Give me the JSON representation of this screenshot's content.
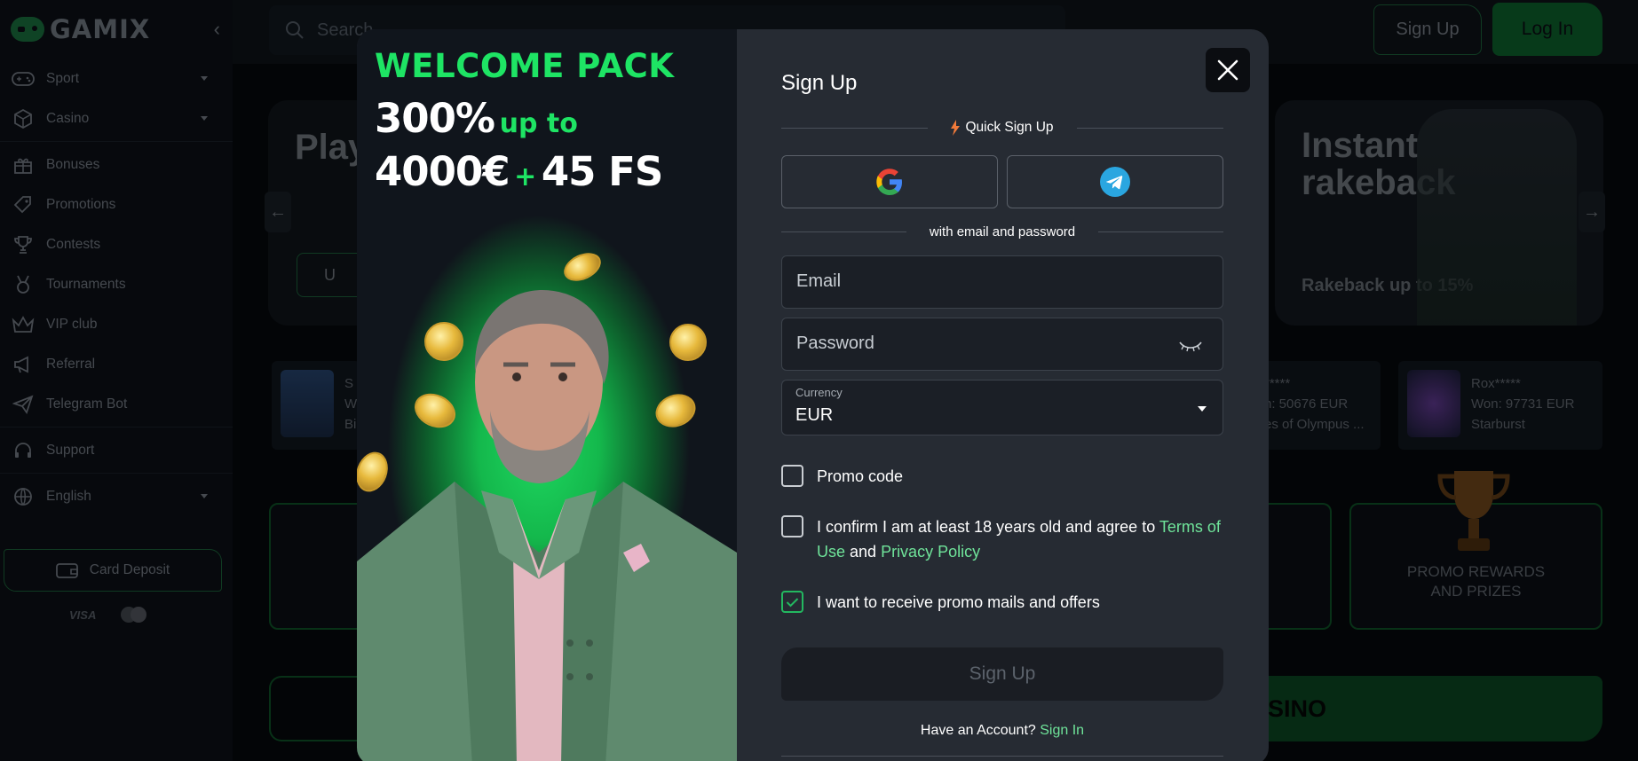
{
  "sidebar": {
    "logo": "GAMIX",
    "items": [
      {
        "label": "Sport"
      },
      {
        "label": "Casino"
      },
      {
        "label": "Bonuses"
      },
      {
        "label": "Promotions"
      },
      {
        "label": "Contests"
      },
      {
        "label": "Tournaments"
      },
      {
        "label": "VIP club"
      },
      {
        "label": "Referral"
      },
      {
        "label": "Telegram Bot"
      },
      {
        "label": "Support"
      },
      {
        "label": "English"
      }
    ],
    "deposit_label": "Card Deposit",
    "visa_label": "VISA"
  },
  "header": {
    "search_placeholder": "Search",
    "signup_label": "Sign Up",
    "login_label": "Log In"
  },
  "background": {
    "hero_left_title": "Play",
    "hero_left_button": "U",
    "hero_right_title": "Instant rakeback",
    "hero_right_sub": "Rakeback up to 15%",
    "winners": [
      {
        "user": "S",
        "amount": "W",
        "game": "Bi"
      },
      {
        "user": "*****",
        "amount": "n: 50676 EUR",
        "game": "es of Olympus ..."
      },
      {
        "user": "Rox*****",
        "amount": "Won: 97731 EUR",
        "game": "Starburst"
      }
    ],
    "promo_tile": "PROMO REWARDS AND PRIZES",
    "casino_banner": "SINO"
  },
  "modal": {
    "promo": {
      "headline": "WELCOME PACK",
      "percent": "300%",
      "up_to": "up to",
      "amount": "4000€",
      "plus": "+",
      "freespins": "45 FS"
    },
    "form": {
      "title": "Sign Up",
      "quick_label": "Quick Sign Up",
      "email_divider": "with email and password",
      "email_placeholder": "Email",
      "password_placeholder": "Password",
      "currency_label": "Currency",
      "currency_value": "EUR",
      "promo_label": "Promo code",
      "confirm_text_1": "I confirm I am at least 18 years old and agree to ",
      "terms_link": "Terms of Use",
      "and_text": " and ",
      "privacy_link": "Privacy Policy",
      "mails_label": "I want to receive promo mails and offers",
      "mails_checked": true,
      "submit_label": "Sign Up",
      "have_account": "Have an Account?",
      "sign_in_link": "Sign In"
    }
  }
}
